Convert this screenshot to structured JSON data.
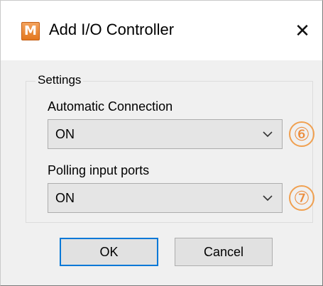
{
  "window": {
    "app_icon_letter": "M",
    "title": "Add I/O Controller",
    "close_glyph": "✕"
  },
  "settings": {
    "group_label": "Settings",
    "automatic_connection": {
      "label": "Automatic Connection",
      "value": "ON",
      "callout": "⑥"
    },
    "polling_input_ports": {
      "label": "Polling input ports",
      "value": "ON",
      "callout": "⑦"
    }
  },
  "buttons": {
    "ok": "OK",
    "cancel": "Cancel"
  },
  "colors": {
    "accent_focus": "#0078d7",
    "callout": "#ec8c3c",
    "app_icon": "#e3781f"
  },
  "icons": {
    "app": "app-logo-icon",
    "close": "close-icon",
    "dropdown": "chevron-down-icon"
  }
}
